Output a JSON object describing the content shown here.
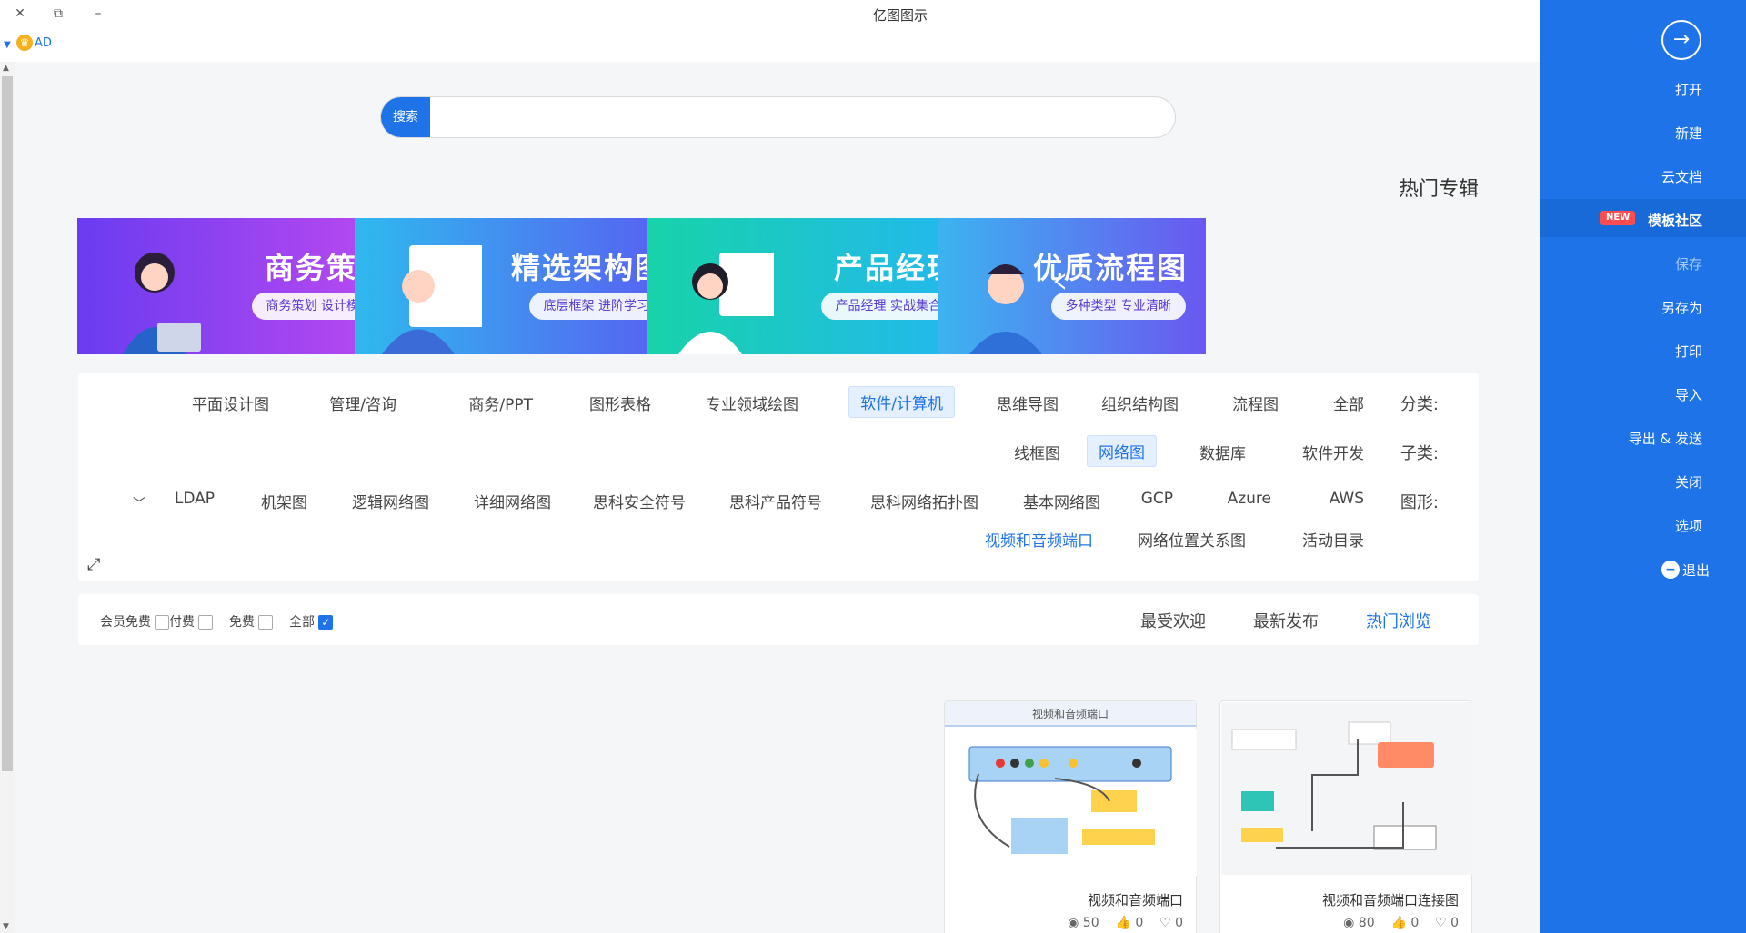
{
  "window": {
    "title": "亿图图示",
    "close_icon": "✕",
    "restore_icon": "⧉",
    "minimize_icon": "–"
  },
  "user": {
    "name": "AD",
    "badge_icon": "crown-icon"
  },
  "search": {
    "button_label": "搜索",
    "placeholder": ""
  },
  "hot_section": {
    "title": "热门专辑"
  },
  "banners": [
    {
      "title": "商务策划",
      "subtitle": "商务策划 设计模板",
      "color_from": "#7f3cf0",
      "color_to": "#b44cf0"
    },
    {
      "title": "精选架构图",
      "subtitle": "底层框架 进阶学习",
      "color_from": "#2fb9ee",
      "color_to": "#5a5cf2"
    },
    {
      "title": "产品经理",
      "subtitle": "产品经理 实战集合",
      "color_from": "#17d3a9",
      "color_to": "#24b6f2"
    },
    {
      "title": "优质流程图",
      "subtitle": "多种类型 专业清晰",
      "color_from": "#3cb4f0",
      "color_to": "#6a58f0"
    }
  ],
  "filters": {
    "category_label": "分类:",
    "categories": [
      "全部",
      "流程图",
      "组织结构图",
      "思维导图",
      "软件/计算机",
      "专业领域绘图",
      "图形表格",
      "商务/PPT",
      "管理/咨询",
      "平面设计图"
    ],
    "active_category": "软件/计算机",
    "sub_label": "子类:",
    "subs": [
      "软件开发",
      "数据库",
      "网络图",
      "线框图"
    ],
    "active_sub": "网络图",
    "shape_label": "图形:",
    "shapes_row1": [
      "AWS",
      "Azure",
      "GCP",
      "基本网络图",
      "思科网络拓扑图",
      "思科产品符号",
      "思科安全符号",
      "详细网络图",
      "逻辑网络图",
      "机架图",
      "LDAP"
    ],
    "shapes_row2": [
      "活动目录",
      "网络位置关系图",
      "视频和音频端口"
    ],
    "active_shape": "视频和音频端口"
  },
  "sort": {
    "tabs": [
      "热门浏览",
      "最新发布",
      "最受欢迎"
    ],
    "active_tab": "热门浏览",
    "checks": [
      {
        "label": "全部",
        "checked": true
      },
      {
        "label": "免费",
        "checked": false
      },
      {
        "label": "付费",
        "checked": false
      },
      {
        "label": "会员免费",
        "checked": false
      }
    ]
  },
  "cards": [
    {
      "title": "视频和音频端口连接图",
      "views": "80",
      "likes": "0",
      "favs": "0",
      "header": ""
    },
    {
      "title": "视频和音频端口",
      "views": "50",
      "likes": "0",
      "favs": "0",
      "header": "视频和音频端口"
    }
  ],
  "sidebar": {
    "items": [
      "打开",
      "新建",
      "云文档",
      "模板社区",
      "保存",
      "另存为",
      "打印",
      "导入",
      "导出 & 发送",
      "关闭",
      "选项",
      "退出"
    ],
    "new_badge": "NEW",
    "active_item": "模板社区"
  },
  "colors": {
    "accent": "#1e73e8",
    "sidebar_bg": "#1e73e8",
    "new_badge": "#ff4d4f"
  }
}
